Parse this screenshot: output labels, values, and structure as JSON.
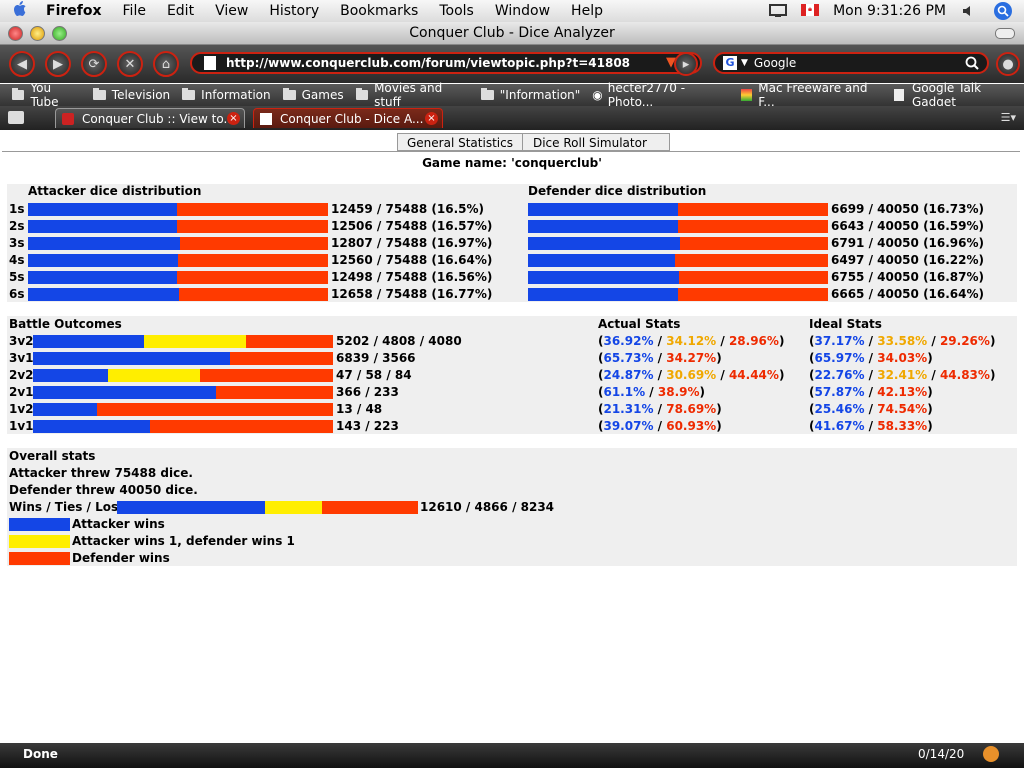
{
  "menubar": {
    "app_name": "Firefox",
    "items": [
      "File",
      "Edit",
      "View",
      "History",
      "Bookmarks",
      "Tools",
      "Window",
      "Help"
    ],
    "clock": "Mon 9:31:26 PM"
  },
  "window": {
    "title": "Conquer Club - Dice Analyzer"
  },
  "toolbar": {
    "url": "http://www.conquerclub.com/forum/viewtopic.php?t=41808",
    "search_engine": "Google"
  },
  "bookmarks": [
    "You Tube",
    "Television",
    "Information",
    "Games",
    "Movies and stuff",
    "\"Information\"",
    "hecter2770 - Photo...",
    "Mac Freeware and F...",
    "Google Talk Gadget"
  ],
  "tabs": [
    {
      "label": "Conquer Club :: View to...",
      "active": false
    },
    {
      "label": "Conquer Club - Dice A...",
      "active": true
    }
  ],
  "page": {
    "stat_tabs": [
      "General Statistics",
      "Dice Roll Simulator"
    ],
    "game_name": "Game name: 'conquerclub'",
    "attacker_header": "Attacker dice distribution",
    "defender_header": "Defender dice distribution",
    "battle_header": "Battle Outcomes",
    "actual_header": "Actual Stats",
    "ideal_header": "Ideal Stats",
    "overall_header": "Overall stats",
    "attacker_threw": "Attacker threw 75488 dice.",
    "defender_threw": "Defender threw 40050 dice.",
    "wtl_label": "Wins / Ties / Loses",
    "wtl_text": "12610 / 4866 / 8234",
    "legend": [
      "Attacker wins",
      "Attacker wins 1, defender wins 1",
      "Defender wins"
    ],
    "colors": {
      "attacker": "#1446e6",
      "tie": "#ffee00",
      "defender": "#ff3a00"
    }
  },
  "chart_data": [
    {
      "type": "bar",
      "title": "Attacker dice distribution",
      "categories": [
        "1s",
        "2s",
        "3s",
        "4s",
        "5s",
        "6s"
      ],
      "values": [
        12459,
        12506,
        12807,
        12560,
        12498,
        12658
      ],
      "total": 75488,
      "labels": [
        "12459 / 75488 (16.5%)",
        "12506 / 75488 (16.57%)",
        "12807 / 75488 (16.97%)",
        "12560 / 75488 (16.64%)",
        "12498 / 75488 (16.56%)",
        "12658 / 75488 (16.77%)"
      ]
    },
    {
      "type": "bar",
      "title": "Defender dice distribution",
      "categories": [
        "1s",
        "2s",
        "3s",
        "4s",
        "5s",
        "6s"
      ],
      "values": [
        6699,
        6643,
        6791,
        6497,
        6755,
        6665
      ],
      "total": 40050,
      "labels": [
        "6699 / 40050 (16.73%)",
        "6643 / 40050 (16.59%)",
        "6791 / 40050 (16.96%)",
        "6497 / 40050 (16.22%)",
        "6755 / 40050 (16.87%)",
        "6665 / 40050 (16.64%)"
      ]
    },
    {
      "type": "bar",
      "title": "Battle Outcomes",
      "rows": [
        {
          "label": "3v2",
          "values": [
            5202,
            4808,
            4080
          ],
          "text": "5202 / 4808 / 4080",
          "actual": [
            "36.92%",
            "34.12%",
            "28.96%"
          ],
          "ideal": [
            "37.17%",
            "33.58%",
            "29.26%"
          ]
        },
        {
          "label": "3v1",
          "values": [
            6839,
            0,
            3566
          ],
          "text": "6839 / 3566",
          "actual": [
            "65.73%",
            "34.27%"
          ],
          "ideal": [
            "65.97%",
            "34.03%"
          ]
        },
        {
          "label": "2v2",
          "values": [
            47,
            58,
            84
          ],
          "text": "47 / 58 / 84",
          "actual": [
            "24.87%",
            "30.69%",
            "44.44%"
          ],
          "ideal": [
            "22.76%",
            "32.41%",
            "44.83%"
          ]
        },
        {
          "label": "2v1",
          "values": [
            366,
            0,
            233
          ],
          "text": "366 / 233",
          "actual": [
            "61.1%",
            "38.9%"
          ],
          "ideal": [
            "57.87%",
            "42.13%"
          ]
        },
        {
          "label": "1v2",
          "values": [
            13,
            0,
            48
          ],
          "text": "13 / 48",
          "actual": [
            "21.31%",
            "78.69%"
          ],
          "ideal": [
            "25.46%",
            "74.54%"
          ]
        },
        {
          "label": "1v1",
          "values": [
            143,
            0,
            223
          ],
          "text": "143 / 223",
          "actual": [
            "39.07%",
            "60.93%"
          ],
          "ideal": [
            "41.67%",
            "58.33%"
          ]
        }
      ]
    },
    {
      "type": "bar",
      "title": "Wins / Ties / Loses",
      "values": [
        12610,
        4866,
        8234
      ]
    }
  ],
  "statusbar": {
    "text": "Done",
    "count": "0/14/20"
  }
}
